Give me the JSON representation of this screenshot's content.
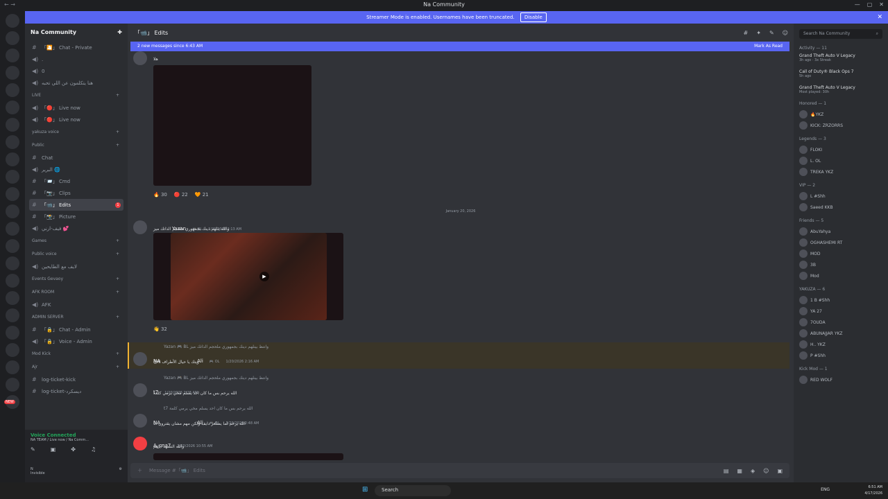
{
  "window": {
    "title": "Na Community",
    "nav": "← →",
    "controls": [
      "—",
      "▢",
      "✕"
    ]
  },
  "banner": {
    "text": "Streamer Mode is enabled. Usernames have been truncated.",
    "button": "Disable",
    "close": "✕"
  },
  "server": {
    "name": "Na Community"
  },
  "channels": [
    {
      "type": "text",
      "label": "「🎦」 Chat - Private"
    },
    {
      "type": "voice",
      "label": "."
    },
    {
      "type": "voice",
      "label": "0"
    },
    {
      "type": "voice",
      "label": "هنا يتكلمون عن اللي تحبه"
    },
    {
      "type": "category",
      "label": "LIVE"
    },
    {
      "type": "voice",
      "label": "「🔴」 Live now"
    },
    {
      "type": "voice",
      "label": "「🔴」 Live now"
    },
    {
      "type": "category",
      "label": "yakuza voice"
    },
    {
      "type": "category",
      "label": "Public"
    },
    {
      "type": "text",
      "label": "Chat"
    },
    {
      "type": "voice",
      "label": "البرير 🌐"
    },
    {
      "type": "text",
      "label": "「📨」 Cmd"
    },
    {
      "type": "text",
      "label": "「📷」 Clips"
    },
    {
      "type": "text",
      "label": "「📹」 Edits",
      "active": true,
      "mention": "1"
    },
    {
      "type": "text",
      "label": "「📸」 Picture"
    },
    {
      "type": "voice",
      "label": "فيف-ارني 💕"
    },
    {
      "type": "category",
      "label": "Games"
    },
    {
      "type": "category",
      "label": "Public voice"
    },
    {
      "type": "voice",
      "label": "لايف مع الطايحين"
    },
    {
      "type": "category",
      "label": "Events Gevaoy"
    },
    {
      "type": "category",
      "label": "AFK ROOM"
    },
    {
      "type": "voice",
      "label": "AFK"
    },
    {
      "type": "category",
      "label": "ADMIN SERVER"
    },
    {
      "type": "text",
      "label": "「🔒」 Chat - Admin"
    },
    {
      "type": "voice",
      "label": "「🔒」 Voice - Admin"
    },
    {
      "type": "category",
      "label": "Mod Kick"
    },
    {
      "type": "category",
      "label": "Ajr"
    },
    {
      "type": "text",
      "label": "log-ticket-kick"
    },
    {
      "type": "text",
      "label": "log-ticket-ديسكرد"
    }
  ],
  "voice": {
    "status": "Voice Connected",
    "sub": "NA TEAM / Live now / Na Comm..."
  },
  "user": {
    "name": "N",
    "status": "Invisible"
  },
  "header": {
    "channel": "「📹」 Edits"
  },
  "newmsg": {
    "text": "2 new messages since 6:43 AM",
    "action": "Mark As Read"
  },
  "messages": {
    "first_text": "هلا",
    "reactions1": [
      {
        "emoji": "🔥",
        "count": "30"
      },
      {
        "emoji": "🔴",
        "count": "22"
      },
      {
        "emoji": "🧡",
        "count": "21"
      }
    ],
    "date": "January 20, 2026",
    "m2_author": "Yazan",
    "m2_tag": "🎮 BL",
    "m2_time": "1/20/2026 2:13 AM",
    "m2_text": "والله ينلهم دينك بجمهوري ملحجم الذاتك ميز",
    "reactions2": [
      {
        "emoji": "👋",
        "count": "32"
      }
    ],
    "reply1": "Yazan 🎮 BL وانتظ بينلهم دينك بجمهوري ملحجم الذاتك ميز",
    "m3_author": "NA",
    "m3_author2": "Ali",
    "m3_tag": "🎮 OL",
    "m3_time": "1/20/2026 2:16 AM",
    "m3_text": "@N ويتك يا حيال الأطراف",
    "reply2": "Yazan 🎮 BL وانتظ بينلهم دينك بجمهوري ملحجم الذاتك ميز",
    "m4_author": "t7",
    "m4_time": "1/20/2026 2:28 AM",
    "m4_text": "الله يرحم بس ما كان احد يسلم مخي يرمي كلمة",
    "reply3": "t7 الله يرحم بس ما كان احد يسلم مخي يرمي كلمة",
    "m5_author": "NA",
    "m5_author2": "Ali",
    "m5_tag": "🎮 OL",
    "m5_time": "1/20/2026 2:48 AM",
    "m5_text": "الله يرحم لما يسلعر دايف ولكن مهم مشان يقترون انا",
    "m6_author": "A_cna7",
    "m6_time": "1/20/2026 10:55 AM",
    "m6_text": "والله التسهد اياهم"
  },
  "composer": {
    "placeholder": "Message #「📹」 Edits"
  },
  "right": {
    "search_placeholder": "Search Na Community",
    "activity_title": "Activity — 11",
    "activities": [
      {
        "game": "Grand Theft Auto V Legacy",
        "sub": "3h ago · 3x Streak"
      },
      {
        "game": "Call of Duty® Black Ops 7",
        "sub": "5h ago"
      },
      {
        "game": "Grand Theft Auto V Legacy",
        "sub": "Most played: 30h"
      }
    ],
    "sections": [
      {
        "title": "Honored — 1",
        "members": [
          "🔥YKZ",
          "KICK: ZRZORRS"
        ]
      },
      {
        "title": "Legends — 3",
        "members": [
          "FLOKI",
          "L. OL",
          "TREKA YKZ"
        ]
      },
      {
        "title": "VIP — 2",
        "members": [
          "L #Shh",
          "Saeed KKB"
        ]
      },
      {
        "title": "Friends — 5",
        "members": [
          "AbuYahya",
          "OGHASHEMI RT",
          "MOD",
          "3B",
          "Mod"
        ]
      },
      {
        "title": "YAKUZA — 6",
        "members": [
          "1 B #Shh",
          "YA 27",
          "7OUDA",
          "ABUNAJJAR YKZ",
          "H.. YKZ",
          "P #Shh"
        ]
      },
      {
        "title": "Kick Mod — 1",
        "members": [
          "RED WOLF"
        ]
      }
    ]
  },
  "taskbar": {
    "search": "Search",
    "lang": "ENG",
    "time": "6:51 AM",
    "date": "4/17/2026"
  }
}
